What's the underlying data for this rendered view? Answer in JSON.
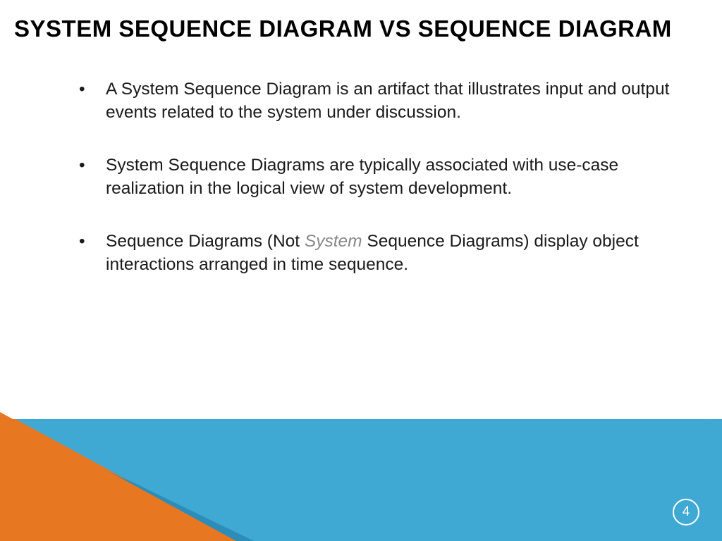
{
  "title": "SYSTEM SEQUENCE DIAGRAM VS SEQUENCE DIAGRAM",
  "bullets": [
    {
      "text": "A System Sequence Diagram is an artifact that illustrates input and output events related to the system under discussion."
    },
    {
      "text": "System Sequence Diagrams are typically associated with use-case realization in the logical view of system development."
    },
    {
      "prefix": "Sequence Diagrams (Not ",
      "italic": "System",
      "suffix": " Sequence Diagrams) display object interactions arranged in time sequence."
    }
  ],
  "pageNumber": "4",
  "colors": {
    "orange": "#e87722",
    "blueLight": "#3fa9d4",
    "blueDark": "#2b8db8"
  }
}
